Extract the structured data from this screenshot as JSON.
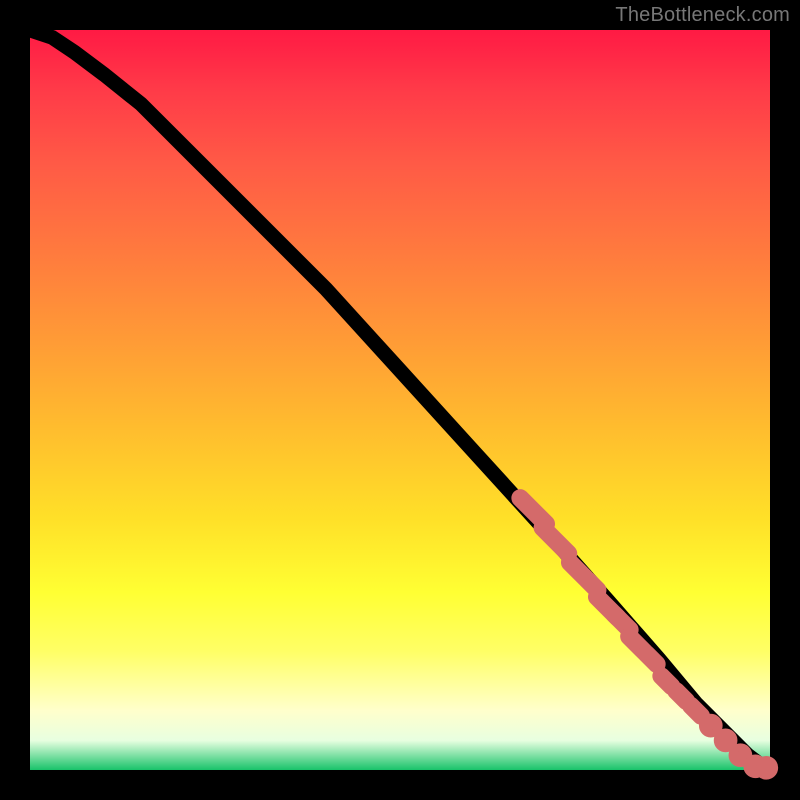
{
  "watermark": "TheBottleneck.com",
  "chart_data": {
    "type": "line",
    "title": "",
    "xlabel": "",
    "ylabel": "",
    "xlim": [
      0,
      100
    ],
    "ylim": [
      0,
      100
    ],
    "series": [
      {
        "name": "curve",
        "x": [
          0,
          3,
          6,
          10,
          15,
          20,
          30,
          40,
          50,
          60,
          70,
          78,
          85,
          90,
          94,
          97,
          99,
          100
        ],
        "y": [
          100,
          99,
          97,
          94,
          90,
          85,
          75,
          65,
          54,
          43,
          32,
          23,
          15,
          9,
          5,
          2,
          0.5,
          0.2
        ]
      }
    ],
    "markers": {
      "comment": "salmon capsule/dot markers along the lower-right portion of the curve",
      "points": [
        {
          "x": 68,
          "y": 35,
          "len": 5
        },
        {
          "x": 71,
          "y": 31,
          "len": 5
        },
        {
          "x": 74,
          "y": 27,
          "len": 3
        },
        {
          "x": 76,
          "y": 25,
          "len": 2
        },
        {
          "x": 78,
          "y": 22,
          "len": 4
        },
        {
          "x": 80,
          "y": 20,
          "len": 3
        },
        {
          "x": 82,
          "y": 17,
          "len": 3
        },
        {
          "x": 84,
          "y": 15,
          "len": 2
        },
        {
          "x": 86,
          "y": 12,
          "len": 2
        },
        {
          "x": 88,
          "y": 10,
          "len": 2
        },
        {
          "x": 90,
          "y": 8,
          "len": 2
        },
        {
          "x": 92,
          "y": 6,
          "len": 1
        },
        {
          "x": 94,
          "y": 4,
          "len": 1
        },
        {
          "x": 96,
          "y": 2,
          "len": 1
        },
        {
          "x": 98,
          "y": 0.5,
          "len": 1
        },
        {
          "x": 99.5,
          "y": 0.3,
          "len": 1
        }
      ]
    }
  }
}
